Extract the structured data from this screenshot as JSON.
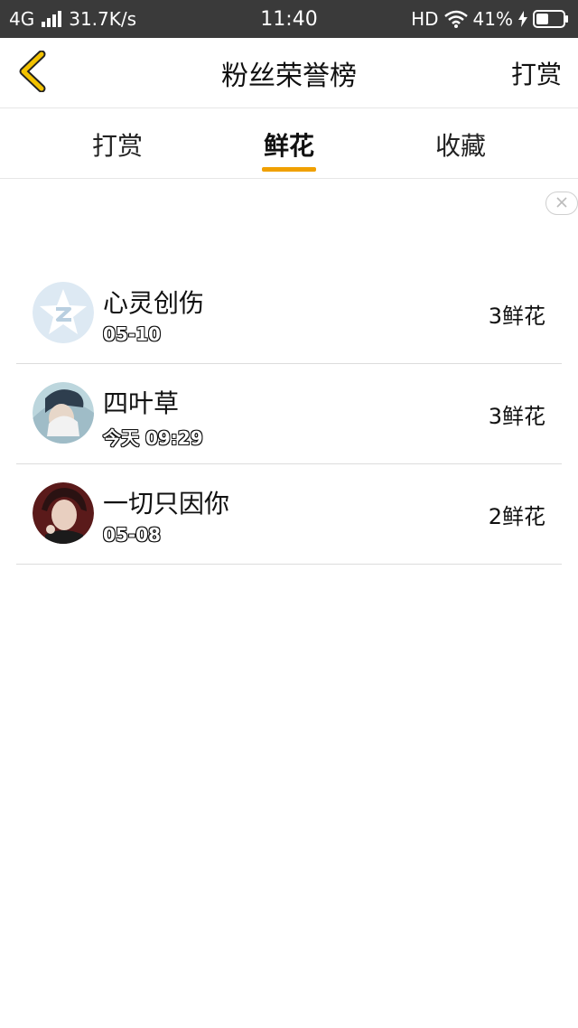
{
  "status_bar": {
    "network": "4G",
    "speed": "31.7K/s",
    "time": "11:40",
    "hd": "HD",
    "battery": "41%"
  },
  "header": {
    "title": "粉丝荣誉榜",
    "action_label": "打赏",
    "back_icon": "chevron-left-icon",
    "accent_color": "#f0a000"
  },
  "tabs": [
    {
      "label": "打赏",
      "selected": false
    },
    {
      "label": "鲜花",
      "selected": true
    },
    {
      "label": "收藏",
      "selected": false
    }
  ],
  "list": [
    {
      "name": "心灵创伤",
      "date": "05-10",
      "count": "3鲜花",
      "avatar": "qq-default-avatar"
    },
    {
      "name": "四叶草",
      "date": "今天 09:29",
      "count": "3鲜花",
      "avatar": "user-photo-avatar"
    },
    {
      "name": "一切只因你",
      "date": "05-08",
      "count": "2鲜花",
      "avatar": "user-photo-avatar"
    }
  ]
}
